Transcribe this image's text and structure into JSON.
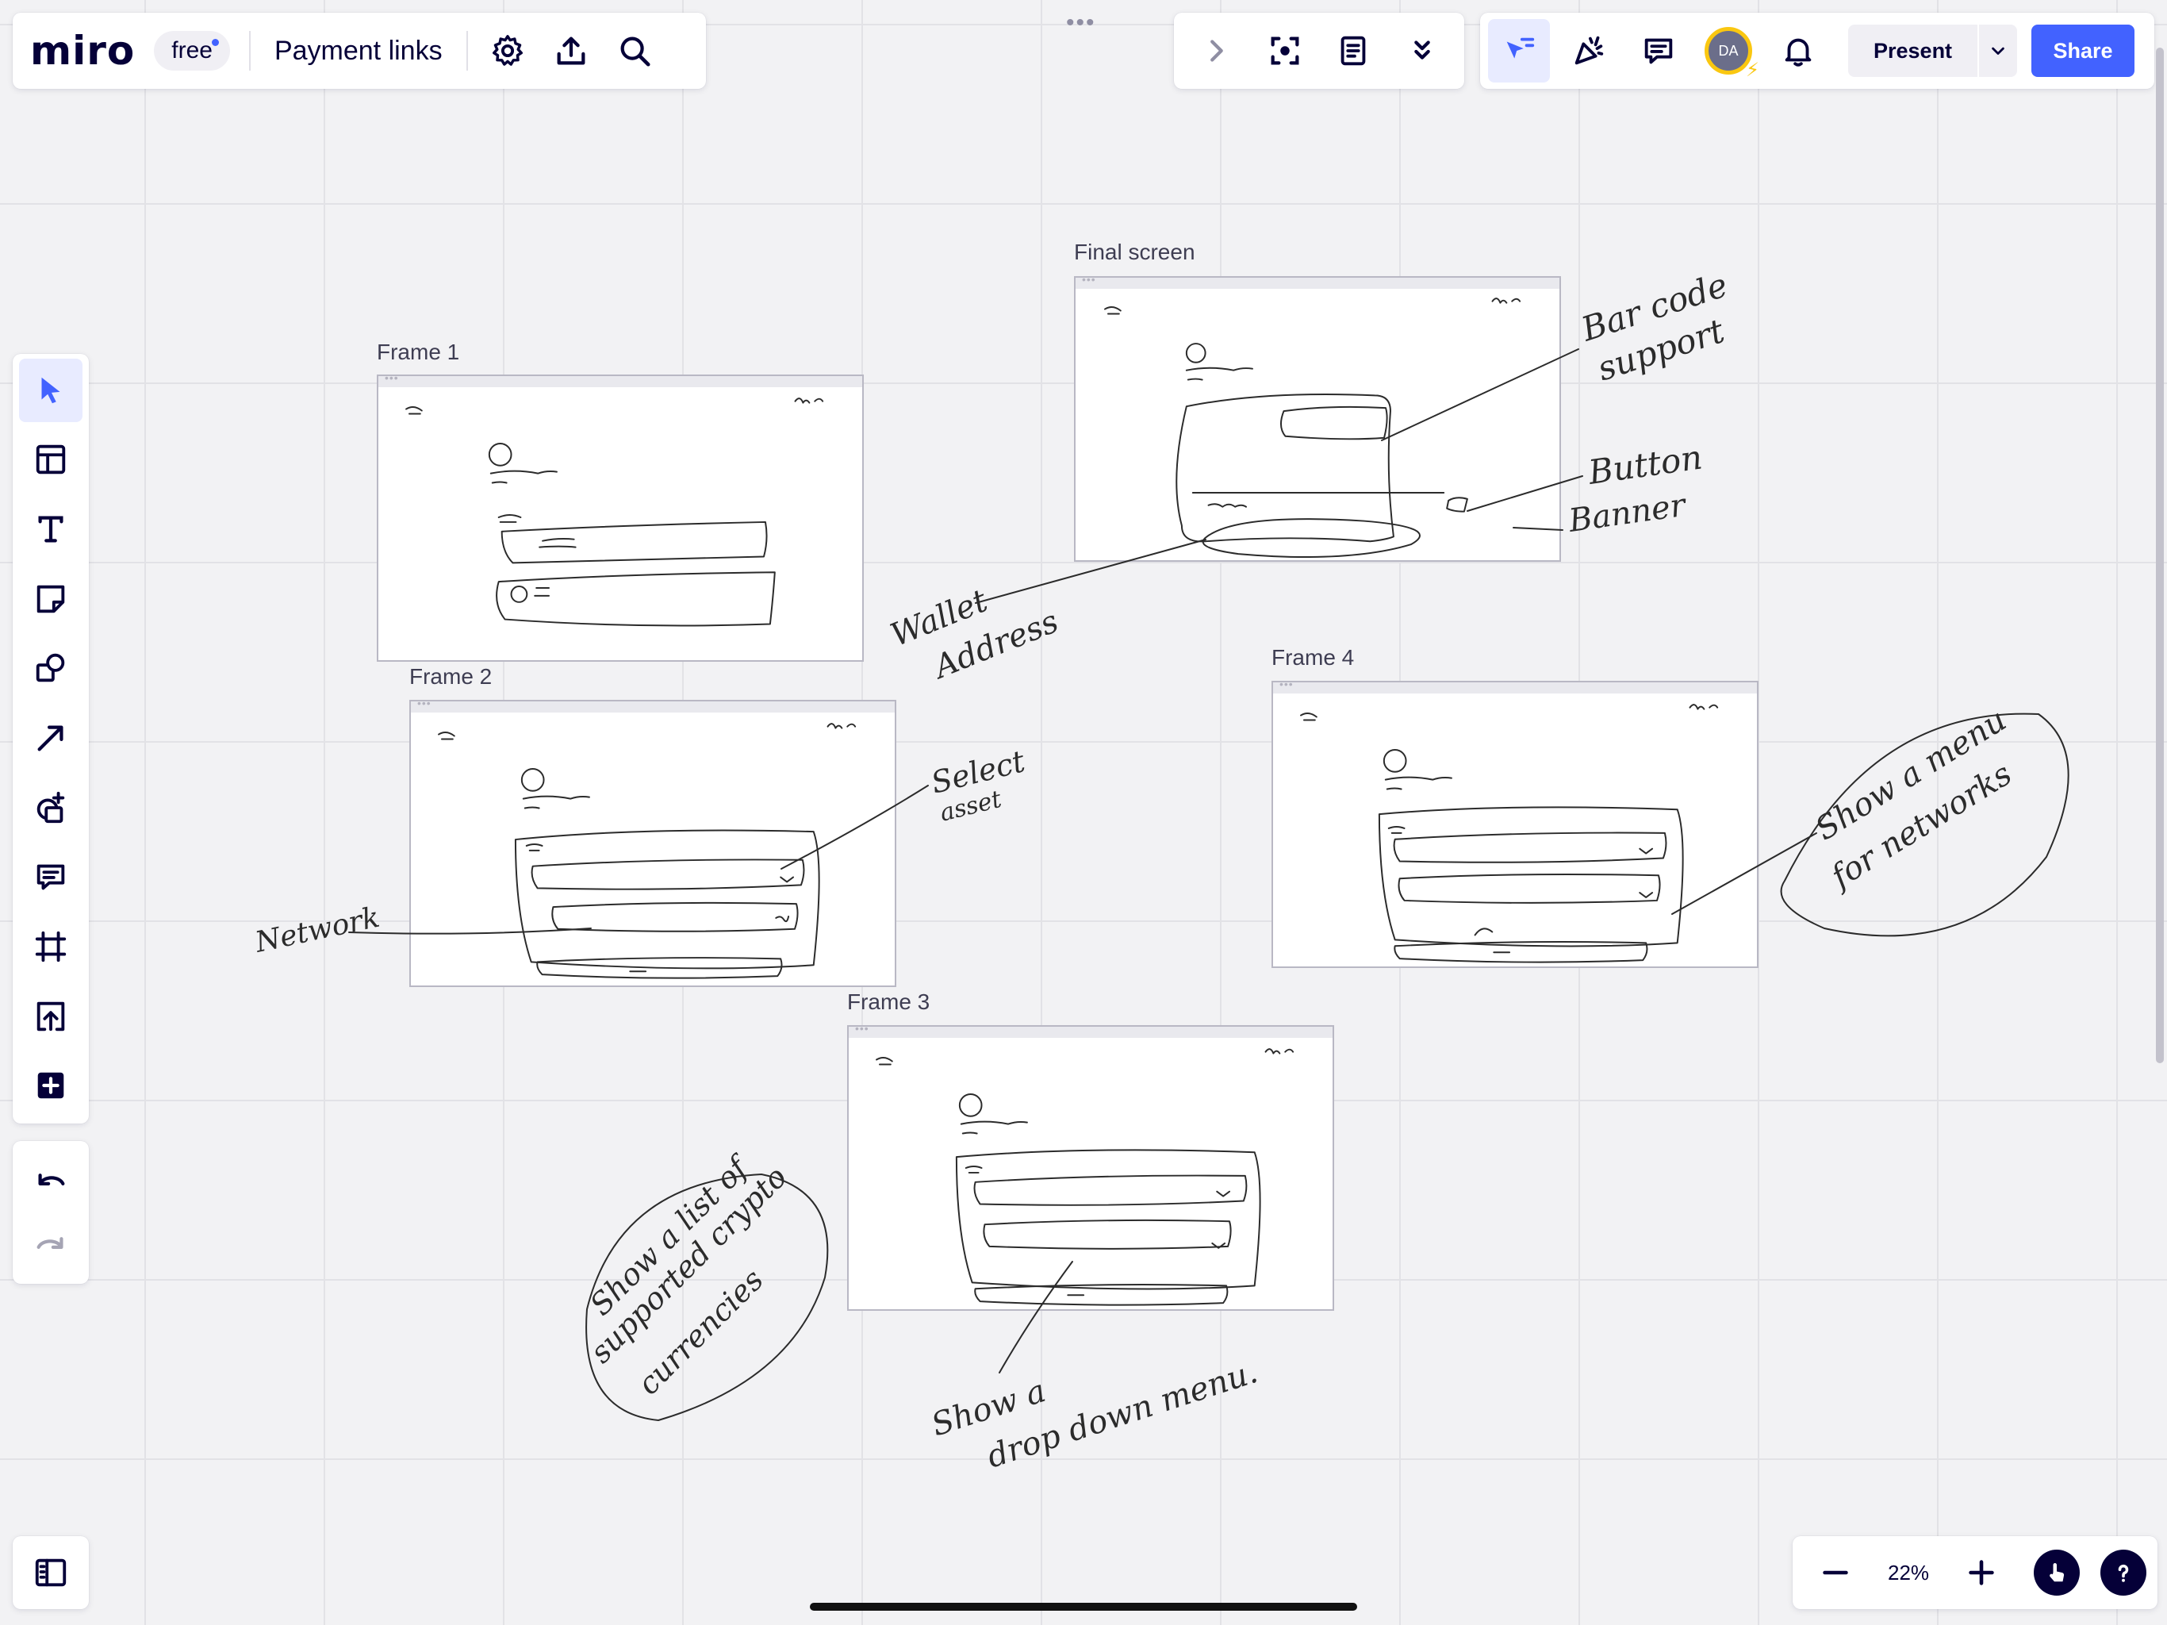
{
  "app": {
    "logo": "miro",
    "plan_badge": "free",
    "board_title": "Payment links"
  },
  "header": {
    "present_label": "Present",
    "share_label": "Share",
    "avatar_initials": "DA"
  },
  "icons": {
    "top_left": [
      "gear-icon",
      "upload-icon",
      "search-icon"
    ],
    "top_center": [
      "chevron-right-icon",
      "focus-icon",
      "notes-icon",
      "double-chevron-down-icon"
    ],
    "top_right": [
      "select-cursor-icon",
      "celebrate-icon",
      "comments-icon",
      "bell-icon"
    ],
    "left_toolbar": [
      "pointer-icon",
      "templates-icon",
      "text-icon",
      "sticky-note-icon",
      "shapes-icon",
      "arrow-icon",
      "shape-add-icon",
      "comment-icon",
      "frame-icon",
      "upload-icon",
      "plus-icon"
    ],
    "history": [
      "undo-icon",
      "redo-icon"
    ]
  },
  "colors": {
    "accent": "#4262ff",
    "dark": "#050038",
    "avatar_ring": "#fac710",
    "canvas": "#f2f2f4"
  },
  "frames": [
    {
      "label": "Final screen"
    },
    {
      "label": "Frame 1"
    },
    {
      "label": "Frame 2"
    },
    {
      "label": "Frame 4"
    },
    {
      "label": "Frame 3"
    }
  ],
  "zoom": {
    "value": "22%"
  }
}
